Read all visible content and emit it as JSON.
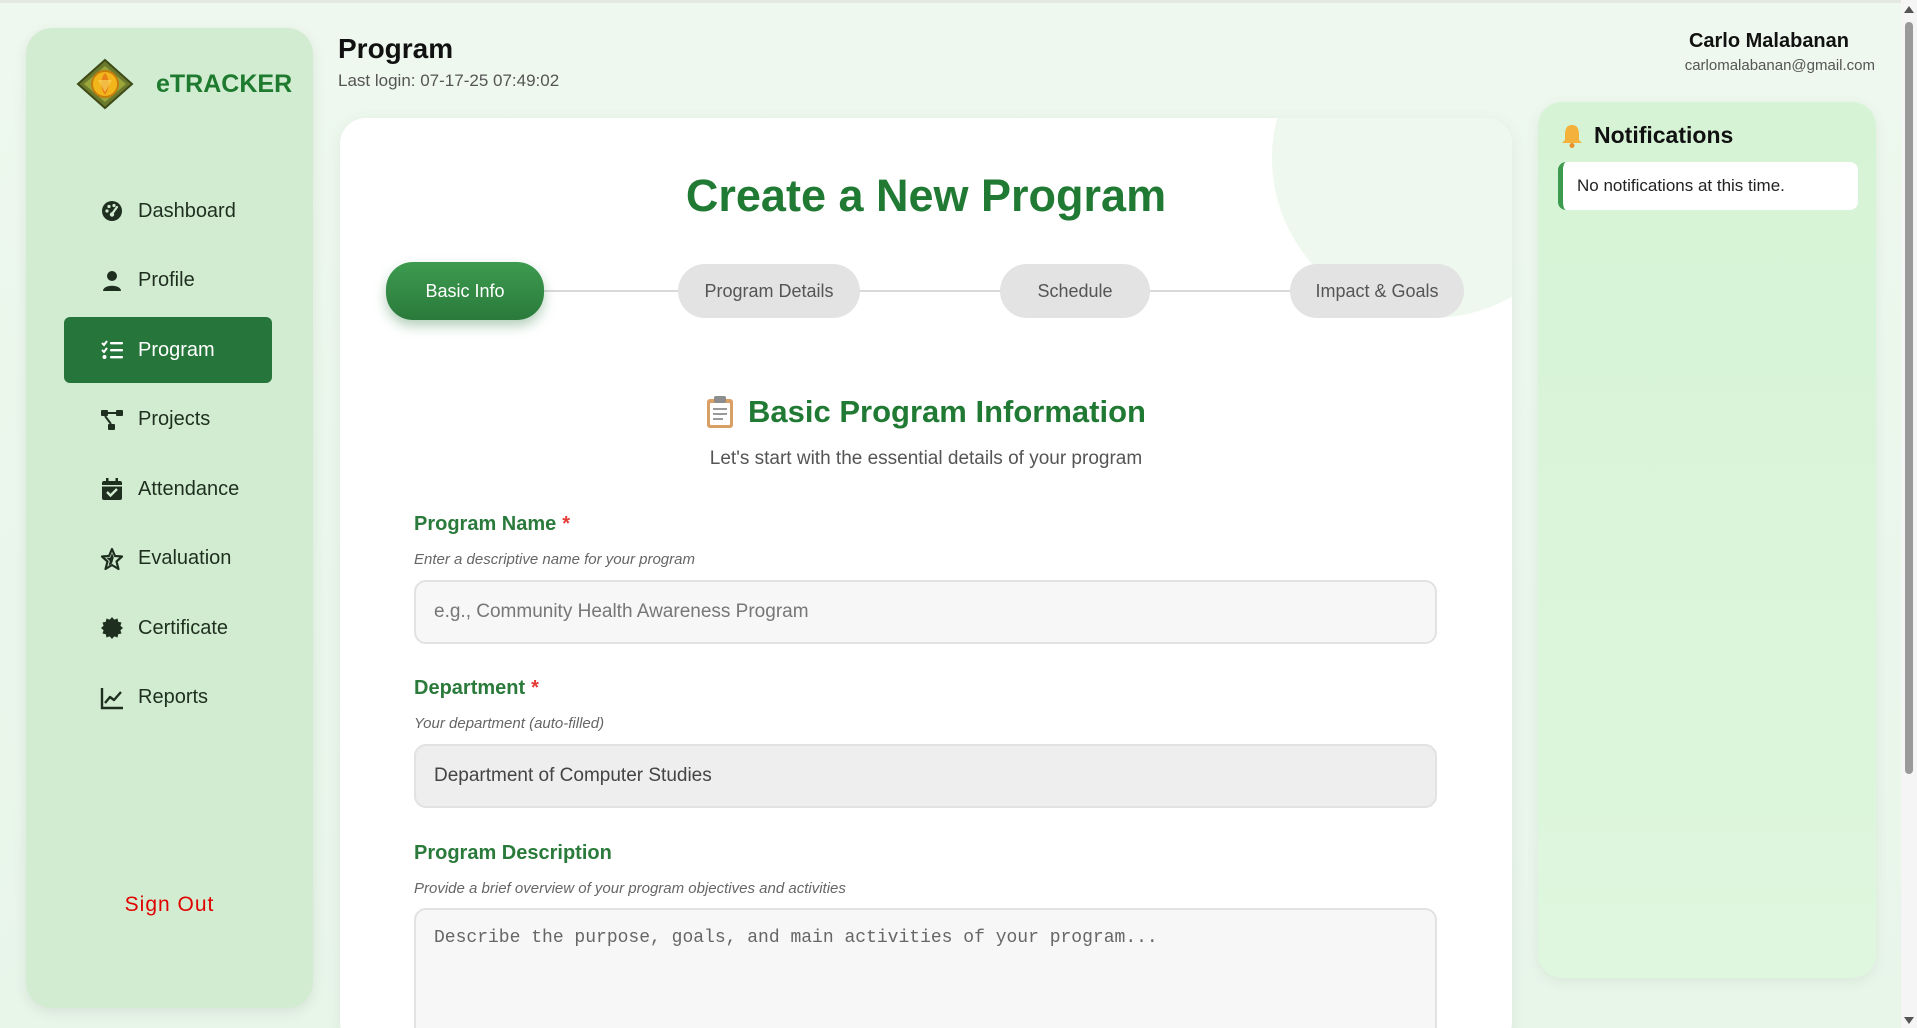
{
  "brand": {
    "name": "eTRACKER"
  },
  "sidebar": {
    "items": [
      {
        "label": "Dashboard",
        "icon": "dashboard-icon",
        "active": false
      },
      {
        "label": "Profile",
        "icon": "user-icon",
        "active": false
      },
      {
        "label": "Program",
        "icon": "list-check-icon",
        "active": true
      },
      {
        "label": "Projects",
        "icon": "project-diagram-icon",
        "active": false
      },
      {
        "label": "Attendance",
        "icon": "calendar-check-icon",
        "active": false
      },
      {
        "label": "Evaluation",
        "icon": "star-icon",
        "active": false
      },
      {
        "label": "Certificate",
        "icon": "certificate-icon",
        "active": false
      },
      {
        "label": "Reports",
        "icon": "chart-line-icon",
        "active": false
      }
    ],
    "sign_out": "Sign Out"
  },
  "header": {
    "title": "Program",
    "last_login": "Last login: 07-17-25 07:49:02"
  },
  "user": {
    "name": "Carlo Malabanan",
    "email": "carlomalabanan@gmail.com"
  },
  "form": {
    "title": "Create a New Program",
    "steps": [
      {
        "label": "Basic Info",
        "active": true
      },
      {
        "label": "Program Details",
        "active": false
      },
      {
        "label": "Schedule",
        "active": false
      },
      {
        "label": "Impact & Goals",
        "active": false
      }
    ],
    "section_title": "Basic Program Information",
    "section_subtitle": "Let's start with the essential details of your program",
    "program_name": {
      "label": "Program Name",
      "required_mark": "*",
      "help": "Enter a descriptive name for your program",
      "placeholder": "e.g., Community Health Awareness Program",
      "value": ""
    },
    "department": {
      "label": "Department",
      "required_mark": "*",
      "help": "Your department (auto-filled)",
      "value": "Department of Computer Studies"
    },
    "description": {
      "label": "Program Description",
      "help": "Provide a brief overview of your program objectives and activities",
      "placeholder": "Describe the purpose, goals, and main activities of your program...",
      "value": ""
    }
  },
  "notifications": {
    "title": "Notifications",
    "empty_message": "No notifications at this time."
  },
  "colors": {
    "primary": "#26753a",
    "heading_green": "#217a34",
    "sidebar_bg": "#d2ecd2",
    "danger": "#e00000"
  }
}
